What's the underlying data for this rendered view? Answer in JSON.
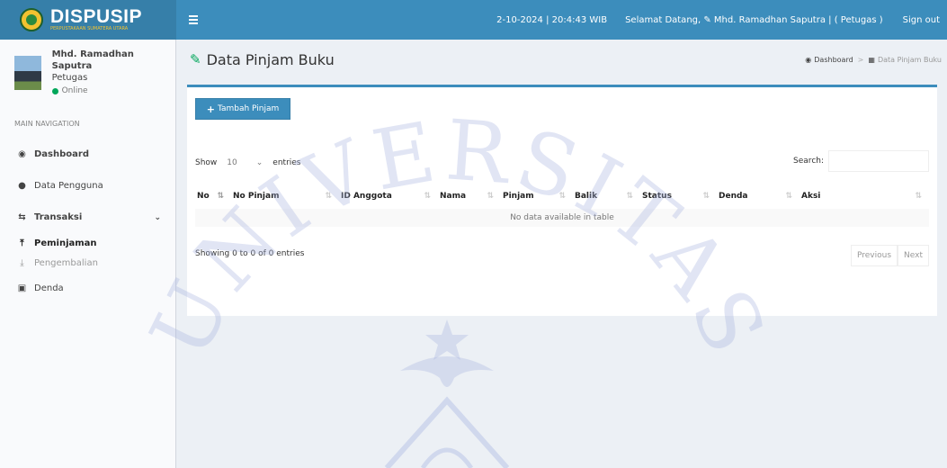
{
  "header": {
    "logo_text": "DISPUSIP",
    "logo_subtitle": "PERPUSTAKAAN SUMATERA UTARA",
    "datetime": "2-10-2024 | 20:4:43 WIB",
    "welcome": "Selamat Datang, ✎ Mhd. Ramadhan Saputra | ( Petugas )",
    "signout_label": "Sign out"
  },
  "sidebar": {
    "user_name": "Mhd. Ramadhan Saputra",
    "user_role": "Petugas",
    "user_status": "Online",
    "menu_header": "MAIN NAVIGATION",
    "items": [
      {
        "label": "Dashboard",
        "icon": "dashboard-icon"
      },
      {
        "label": "Data Pengguna",
        "icon": "user-icon"
      },
      {
        "label": "Transaksi",
        "icon": "exchange-icon"
      },
      {
        "label": "Peminjaman",
        "icon": "upload-icon"
      },
      {
        "label": "Pengembalian",
        "icon": "download-icon"
      },
      {
        "label": "Denda",
        "icon": "money-icon"
      }
    ]
  },
  "content": {
    "page_title": "Data Pinjam Buku",
    "breadcrumb": [
      "Dashboard",
      "Data Pinjam Buku"
    ],
    "add_button_label": "Tambah Pinjam",
    "show_label": "Show",
    "entries_value": "10",
    "entries_label": "entries",
    "search_label": "Search:",
    "columns": [
      "No",
      "No Pinjam",
      "ID Anggota",
      "Nama",
      "Pinjam",
      "Balik",
      "Status",
      "Denda",
      "Aksi"
    ],
    "empty_message": "No data available in table",
    "info_text": "Showing 0 to 0 of 0 entries",
    "prev_label": "Previous",
    "next_label": "Next"
  },
  "watermark_text": "UNIVERSITAS",
  "colors": {
    "navbar": "#3c8dbc",
    "logo_bg": "#367fa9",
    "accent_green": "#00a65a",
    "sidebar_bg": "#f9fafc",
    "content_bg": "#ecf0f5"
  }
}
